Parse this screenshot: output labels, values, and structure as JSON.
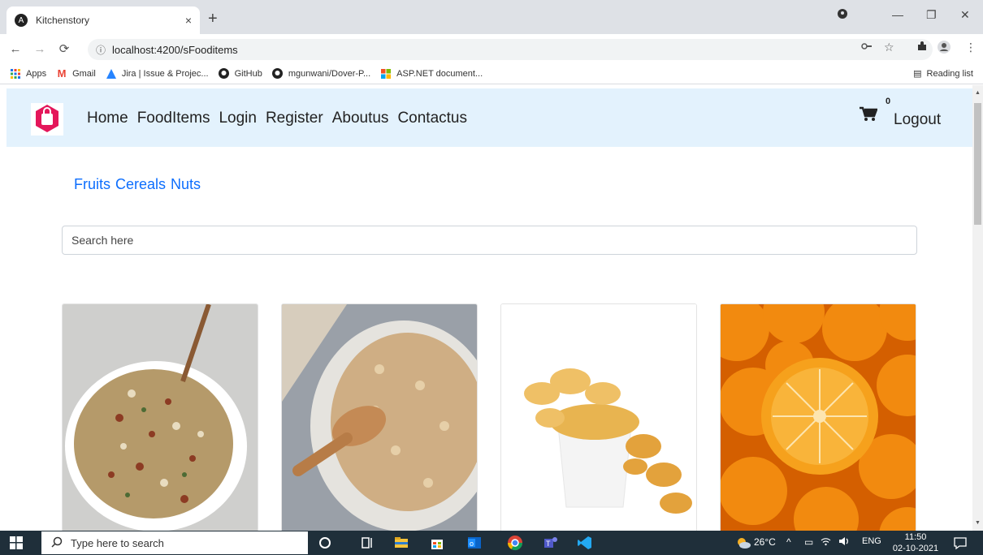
{
  "browser": {
    "tab_title": "Kitchenstory",
    "tab_close": "×",
    "new_tab": "+",
    "url": "localhost:4200/sFooditems",
    "bookmarks": [
      "Apps",
      "Gmail",
      "Jira | Issue & Projec...",
      "GitHub",
      "mgunwani/Dover-P...",
      "ASP.NET document..."
    ],
    "reading_list": "Reading list"
  },
  "navbar": {
    "links": [
      "Home",
      "FoodItems",
      "Login",
      "Register",
      "Aboutus",
      "Contactus"
    ],
    "cart_count": "0",
    "logout": "Logout"
  },
  "categories": [
    "Fruits",
    "Cereals",
    "Nuts"
  ],
  "search": {
    "placeholder": "Search here"
  },
  "products": [
    {
      "name": "granola-bowl"
    },
    {
      "name": "oats-bowl"
    },
    {
      "name": "corn-flakes-cup"
    },
    {
      "name": "oranges"
    }
  ],
  "taskbar": {
    "search_placeholder": "Type here to search",
    "weather": "26°C",
    "language": "ENG",
    "time": "11:50",
    "date": "02-10-2021"
  },
  "colors": {
    "navbar_bg": "#e3f2fd",
    "link_blue": "#0d6efd",
    "taskbar_bg": "#1f2f3a"
  }
}
